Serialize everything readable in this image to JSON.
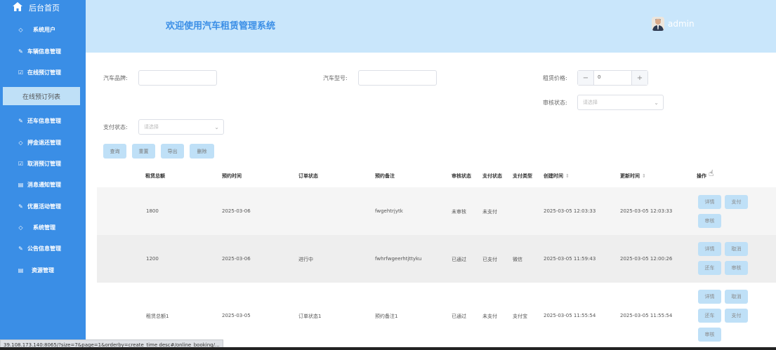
{
  "sidebar": {
    "home": {
      "label": "后台首页",
      "icon": "home-icon"
    },
    "items": [
      {
        "label": "系统用户",
        "icon": "shield-icon"
      },
      {
        "label": "车辆信息管理",
        "icon": "edit-icon"
      },
      {
        "label": "在线预订管理",
        "icon": "checkbox-icon"
      },
      {
        "label": "还车信息管理",
        "icon": "edit-icon"
      },
      {
        "label": "押金退还管理",
        "icon": "shield-icon"
      },
      {
        "label": "取消预订管理",
        "icon": "checkbox-icon"
      },
      {
        "label": "消息通知管理",
        "icon": "doc-icon"
      },
      {
        "label": "优惠活动管理",
        "icon": "edit-icon"
      },
      {
        "label": "系统管理",
        "icon": "shield-icon"
      },
      {
        "label": "公告信息管理",
        "icon": "edit-icon"
      },
      {
        "label": "资源管理",
        "icon": "doc-icon"
      }
    ],
    "active_sub": "在线预订列表"
  },
  "header": {
    "title": "欢迎使用汽车租赁管理系统",
    "user": "admin"
  },
  "filters": {
    "brand_label": "汽车品牌:",
    "model_label": "汽车型号:",
    "price_label": "租赁价格:",
    "price_value": "0",
    "audit_label": "审核状态:",
    "audit_placeholder": "请选择",
    "pay_label": "支付状态:",
    "pay_placeholder": "请选择"
  },
  "actions": {
    "query": "查询",
    "reset": "重置",
    "export": "导出",
    "delete": "删除"
  },
  "table": {
    "columns": [
      "租赁总额",
      "预约时间",
      "订单状态",
      "预约备注",
      "审核状态",
      "支付状态",
      "支付类型",
      "创建时间",
      "更新时间",
      "操作"
    ],
    "rows": [
      {
        "total": "1800",
        "book_time": "2025-03-06",
        "order_status": "",
        "note": "fwgehtrjytk",
        "audit": "未审核",
        "pay_status": "未支付",
        "pay_type": "",
        "created": "2025-03-05 12:03:33",
        "updated": "2025-03-05 12:03:33",
        "ops": [
          "详情",
          "支付",
          "审核"
        ]
      },
      {
        "total": "1200",
        "book_time": "2025-03-06",
        "order_status": "进行中",
        "note": "fwhrfwgeerhtjttyku",
        "audit": "已通过",
        "pay_status": "已支付",
        "pay_type": "微信",
        "created": "2025-03-05 11:59:43",
        "updated": "2025-03-05 12:00:26",
        "ops": [
          "详情",
          "取消",
          "还车",
          "审核"
        ]
      },
      {
        "total": "租赁总额1",
        "book_time": "2025-03-05",
        "order_status": "订单状态1",
        "note": "预约备注1",
        "audit": "已通过",
        "pay_status": "未支付",
        "pay_type": "支付宝",
        "created": "2025-03-05 11:55:54",
        "updated": "2025-03-05 11:55:54",
        "ops": [
          "详情",
          "取消",
          "还车",
          "支付",
          "审核"
        ]
      }
    ]
  },
  "statusbar": {
    "url": "39.108.173.140:8065/?size=7&page=1&orderby=create_time desc#/online_booking/..."
  }
}
